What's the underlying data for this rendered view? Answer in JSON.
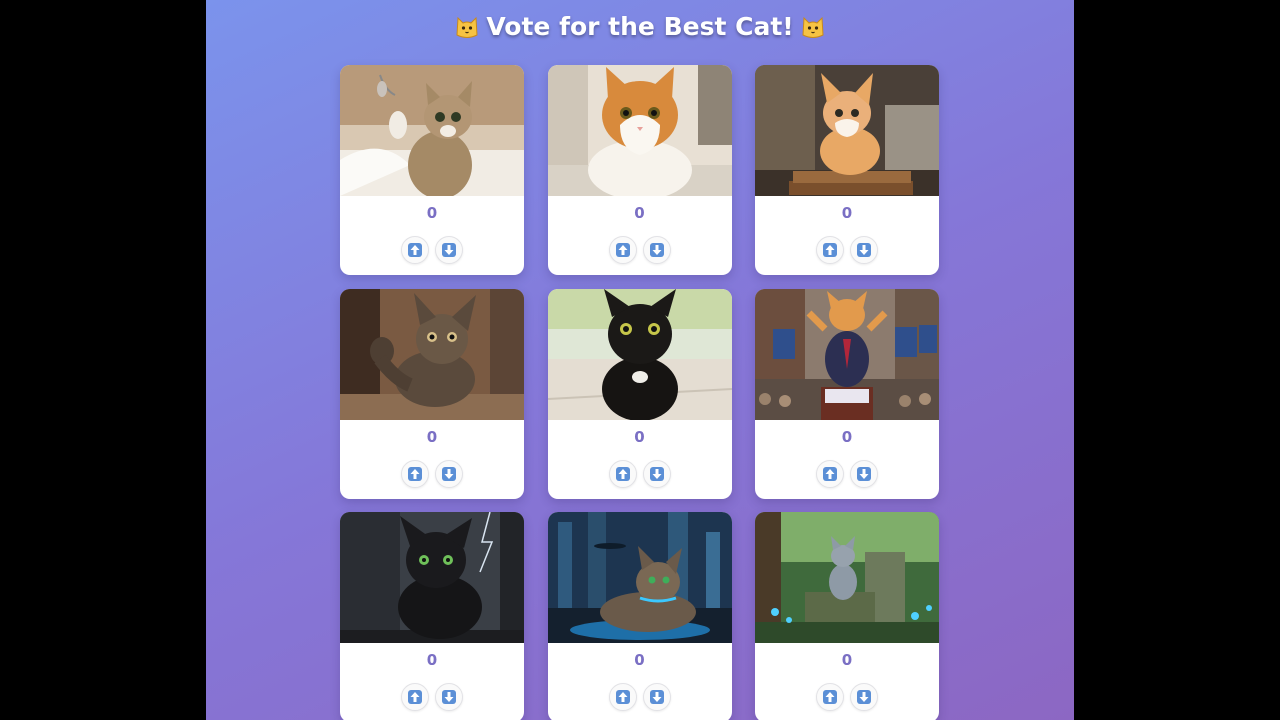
{
  "page": {
    "title": "Vote for the Best Cat!"
  },
  "cats": [
    {
      "name": "playful-tabby-kitten",
      "votes": "0"
    },
    {
      "name": "orange-white-cat",
      "votes": "0"
    },
    {
      "name": "kitten-on-books",
      "votes": "0"
    },
    {
      "name": "waving-tabby-cat",
      "votes": "0"
    },
    {
      "name": "black-cat-indoors",
      "votes": "0"
    },
    {
      "name": "politician-cat",
      "votes": "0"
    },
    {
      "name": "black-cat-storm",
      "votes": "0"
    },
    {
      "name": "cyberpunk-tabby",
      "votes": "0"
    },
    {
      "name": "fantasy-forest-cat",
      "votes": "0"
    }
  ],
  "icons": {
    "upvote": "upvote-arrow-icon",
    "downvote": "downvote-arrow-icon",
    "title_emoji": "cat-face-icon"
  },
  "colors": {
    "accent": "#7a6fc4",
    "button_blue": "#5b8fd6"
  }
}
